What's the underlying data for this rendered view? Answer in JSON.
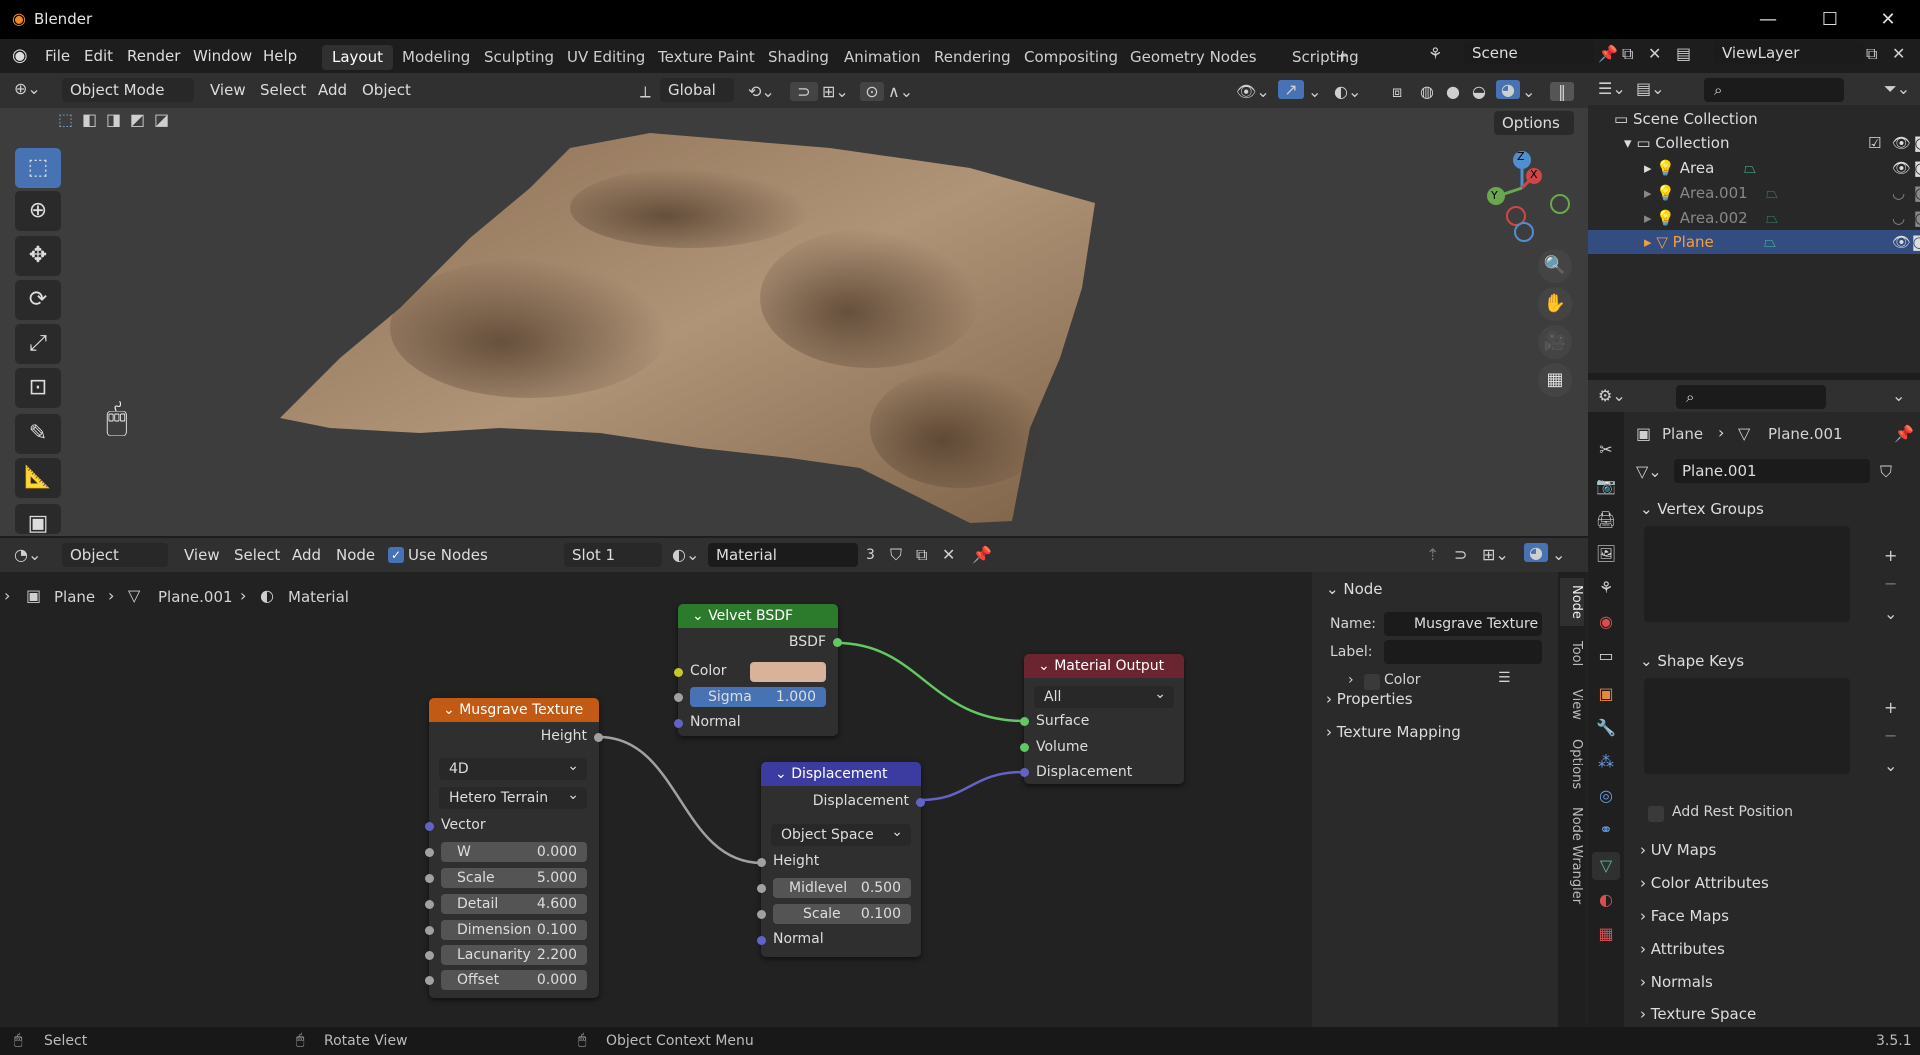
{
  "app": {
    "title": "Blender",
    "version": "3.5.1"
  },
  "menus": [
    "File",
    "Edit",
    "Render",
    "Window",
    "Help"
  ],
  "workspaces": [
    "Layout",
    "Modeling",
    "Sculpting",
    "UV Editing",
    "Texture Paint",
    "Shading",
    "Animation",
    "Rendering",
    "Compositing",
    "Geometry Nodes",
    "Scripting"
  ],
  "scene": "Scene",
  "view_layer": "ViewLayer",
  "viewport": {
    "mode": "Object Mode",
    "menus": [
      "View",
      "Select",
      "Add",
      "Object"
    ],
    "orientation": "Global",
    "options_label": "Options",
    "gizmo": {
      "z": "Z",
      "x": "X",
      "y": "Y"
    }
  },
  "node_editor": {
    "type": "Object",
    "menus": [
      "View",
      "Select",
      "Add",
      "Node"
    ],
    "use_nodes": "Use Nodes",
    "slot": "Slot 1",
    "material": "Material",
    "users": "3",
    "breadcrumb": [
      "Plane",
      "Plane.001",
      "Material"
    ],
    "velvet": {
      "title": "Velvet BSDF",
      "out": "BSDF",
      "color": "Color",
      "color_value": "#d8b39a",
      "sigma_label": "Sigma",
      "sigma": "1.000",
      "normal": "Normal"
    },
    "output": {
      "title": "Material Output",
      "target": "All",
      "surface": "Surface",
      "volume": "Volume",
      "displacement": "Displacement"
    },
    "musgrave": {
      "title": "Musgrave Texture",
      "out": "Height",
      "dim": "4D",
      "type": "Hetero Terrain",
      "vector": "Vector",
      "fields": [
        {
          "label": "W",
          "value": "0.000"
        },
        {
          "label": "Scale",
          "value": "5.000"
        },
        {
          "label": "Detail",
          "value": "4.600"
        },
        {
          "label": "Dimension",
          "value": "0.100"
        },
        {
          "label": "Lacunarity",
          "value": "2.200"
        },
        {
          "label": "Offset",
          "value": "0.000"
        }
      ]
    },
    "disp": {
      "title": "Displacement",
      "out": "Displacement",
      "space": "Object Space",
      "height": "Height",
      "midlevel_label": "Midlevel",
      "midlevel": "0.500",
      "scale_label": "Scale",
      "scale": "0.100",
      "normal": "Normal"
    },
    "side": {
      "title": "Node",
      "name_label": "Name:",
      "name": "Musgrave Texture",
      "label_label": "Label:",
      "color": "Color",
      "properties": "Properties",
      "mapping": "Texture Mapping",
      "tabs": [
        "Node",
        "Tool",
        "View",
        "Options",
        "Node Wrangler"
      ]
    }
  },
  "outliner": {
    "root": "Scene Collection",
    "collection": "Collection",
    "items": [
      "Area",
      "Area.001",
      "Area.002",
      "Plane"
    ]
  },
  "properties": {
    "crumb_obj": "Plane",
    "crumb_data": "Plane.001",
    "mesh_name": "Plane.001",
    "sections": {
      "vertex_groups": "Vertex Groups",
      "shape_keys": "Shape Keys",
      "add_rest": "Add Rest Position",
      "uv": "UV Maps",
      "color_attr": "Color Attributes",
      "face_maps": "Face Maps",
      "attributes": "Attributes",
      "normals": "Normals",
      "tex_space": "Texture Space"
    }
  },
  "status": {
    "select": "Select",
    "rotate": "Rotate View",
    "context": "Object Context Menu"
  }
}
